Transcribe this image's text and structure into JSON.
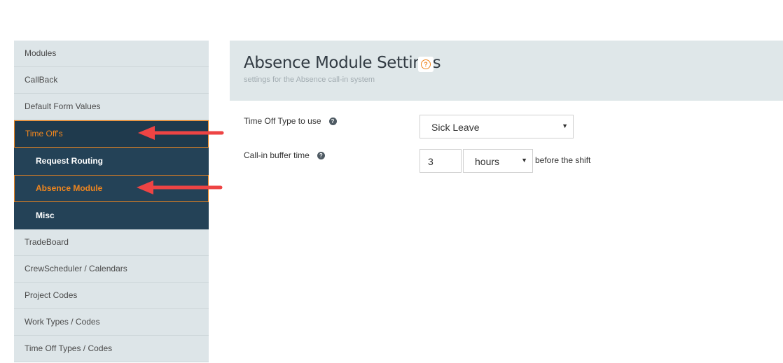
{
  "sidebar": {
    "items": [
      {
        "label": "Modules"
      },
      {
        "label": "CallBack"
      },
      {
        "label": "Default Form Values"
      },
      {
        "label": "Time Off's"
      },
      {
        "label": "Request Routing"
      },
      {
        "label": "Absence Module"
      },
      {
        "label": "Misc"
      },
      {
        "label": "TradeBoard"
      },
      {
        "label": "CrewScheduler / Calendars"
      },
      {
        "label": "Project Codes"
      },
      {
        "label": "Work Types / Codes"
      },
      {
        "label": "Time Off Types / Codes"
      }
    ]
  },
  "header": {
    "title": "Absence Module Settings",
    "help_icon": "question-circle-icon",
    "help_glyph": "?",
    "subtitle": "settings for the Absence call-in system"
  },
  "form": {
    "time_off_type": {
      "label": "Time Off Type to use",
      "value": "Sick Leave",
      "info_icon": "question-circle-icon",
      "info_glyph": "?"
    },
    "call_in_buffer": {
      "label": "Call-in buffer time",
      "info_icon": "question-circle-icon",
      "info_glyph": "?",
      "amount": "3",
      "unit": "hours",
      "suffix": "before the shift"
    },
    "caret_glyph": "▼"
  },
  "annotations": {
    "arrow_color": "#ee4444"
  },
  "colors": {
    "accent": "#f0861e",
    "sidebar_dark": "#1f3a4d",
    "sidebar_light": "#dde5e8"
  }
}
